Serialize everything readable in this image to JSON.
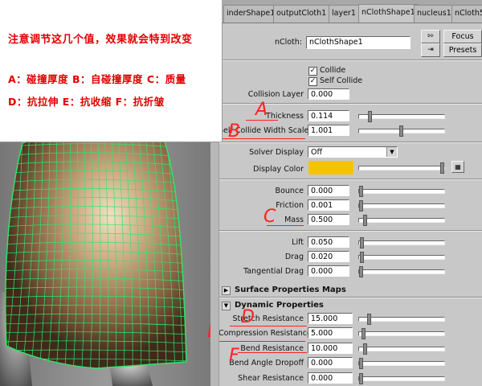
{
  "note": {
    "line1": "注意调节这几个值，效果就会特到改变",
    "line2": "A：碰撞厚度 B：自碰撞厚度 C：质量",
    "line3": "D：抗拉伸 E：抗收缩 F：抗折皱"
  },
  "tabs": [
    {
      "label": "inderShape1",
      "active": false
    },
    {
      "label": "outputCloth1",
      "active": false
    },
    {
      "label": "layer1",
      "active": false
    },
    {
      "label": "nClothShape1",
      "active": true
    },
    {
      "label": "nucleus1",
      "active": false
    },
    {
      "label": "nCloth5",
      "active": false
    }
  ],
  "header": {
    "node_label": "nCloth:",
    "node_value": "nClothShape1",
    "focus_label": "Focus",
    "presets_label": "Presets"
  },
  "collisions": {
    "collide_label": "Collide",
    "collide_checked": true,
    "self_collide_label": "Self Collide",
    "self_collide_checked": true,
    "collision_layer_label": "Collision Layer",
    "collision_layer_value": "0.000",
    "thickness_label": "Thickness",
    "thickness_value": "0.114",
    "thickness_slider": 0.11,
    "self_width_label": "Self Collide Width Scale",
    "self_width_value": "1.001",
    "self_width_slider": 0.5,
    "solver_display_label": "Solver Display",
    "solver_display_value": "Off",
    "display_color_label": "Display Color",
    "display_color": "#f5c400"
  },
  "physics": {
    "bounce_label": "Bounce",
    "bounce_value": "0.000",
    "friction_label": "Friction",
    "friction_value": "0.001",
    "mass_label": "Mass",
    "mass_value": "0.500",
    "lift_label": "Lift",
    "lift_value": "0.050",
    "drag_label": "Drag",
    "drag_value": "0.020",
    "tdrag_label": "Tangential Drag",
    "tdrag_value": "0.000"
  },
  "sections": {
    "surface_maps": "Surface Properties Maps",
    "dynamic": "Dynamic Properties"
  },
  "dynamic": {
    "stretch_label": "Stretch Resistance",
    "stretch_value": "15.000",
    "compression_label": "Compression Resistance",
    "compression_value": "5.000",
    "bend_label": "Bend Resistance",
    "bend_value": "10.000",
    "bend_dropoff_label": "Bend Angle Dropoff",
    "bend_dropoff_value": "0.000",
    "shear_label": "Shear Resistance",
    "shear_value": "0.000"
  },
  "annotations": {
    "A": "A",
    "B": "B",
    "C": "C",
    "D": "D",
    "E": "E",
    "F": "F",
    "color": "#ff2020"
  },
  "colors": {
    "mesh_green": "#2ee86a",
    "skirt_base": "#8a6a4a",
    "skirt_highlight": "#e8d2b0",
    "editor_bg": "#c8c8c8"
  }
}
